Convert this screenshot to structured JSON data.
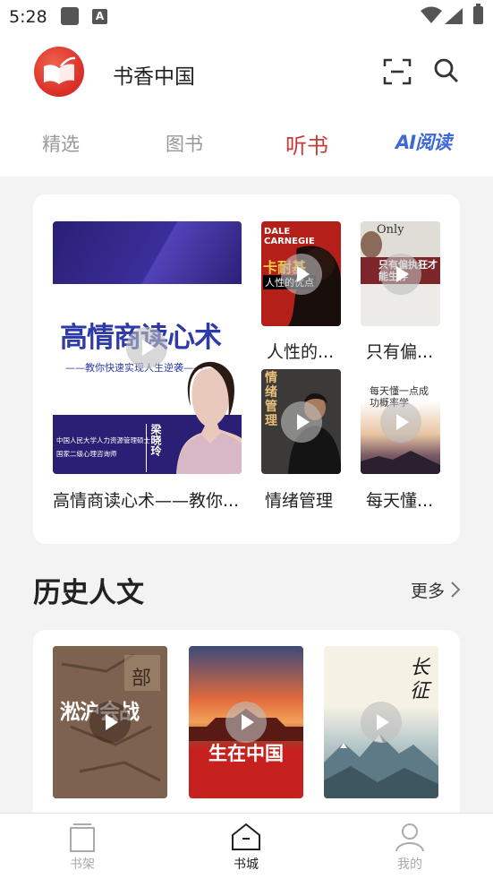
{
  "status_bar": {
    "time": "5:28",
    "notification_letter": "A"
  },
  "app": {
    "title": "书香中国"
  },
  "tabs": [
    {
      "label": "精选",
      "active": false
    },
    {
      "label": "图书",
      "active": false
    },
    {
      "label": "听书",
      "active": true
    },
    {
      "label": "AI阅读",
      "active": false
    }
  ],
  "featured": {
    "main": {
      "label": "高情商读心术——教你...",
      "cover_title": "高情商读心术",
      "cover_subtitle": "——教你快速实现人生逆袭——",
      "cover_person_lines": [
        "中国人民大学人力资源管理硕士",
        "国家二级心理咨询师"
      ],
      "cover_person_name": "梁晓玲"
    },
    "items": [
      {
        "label": "人性的...",
        "cover_top": "DALE CARNEGIE",
        "cover_title": "卡耐基",
        "cover_subtitle": "人性的优点"
      },
      {
        "label": "只有偏...",
        "cover_top": "Only",
        "cover_title": "只有偏执狂才能生存"
      },
      {
        "label": "情绪管理",
        "cover_title": "情绪管理"
      },
      {
        "label": "每天懂...",
        "cover_title": "每天懂一点成功概率学"
      }
    ]
  },
  "history": {
    "title": "历史人文",
    "more_label": "更多",
    "items": [
      {
        "cover_title": "淞沪会战",
        "cover_corner": "部"
      },
      {
        "cover_title": "生在中国"
      },
      {
        "cover_title": "长征"
      }
    ]
  },
  "bottom_nav": [
    {
      "label": "书架",
      "active": false
    },
    {
      "label": "书城",
      "active": true
    },
    {
      "label": "我的",
      "active": false
    }
  ],
  "colors": {
    "accent": "#c83a33",
    "ai": "#3e6ad8",
    "page_bg": "#f4f3f4"
  }
}
